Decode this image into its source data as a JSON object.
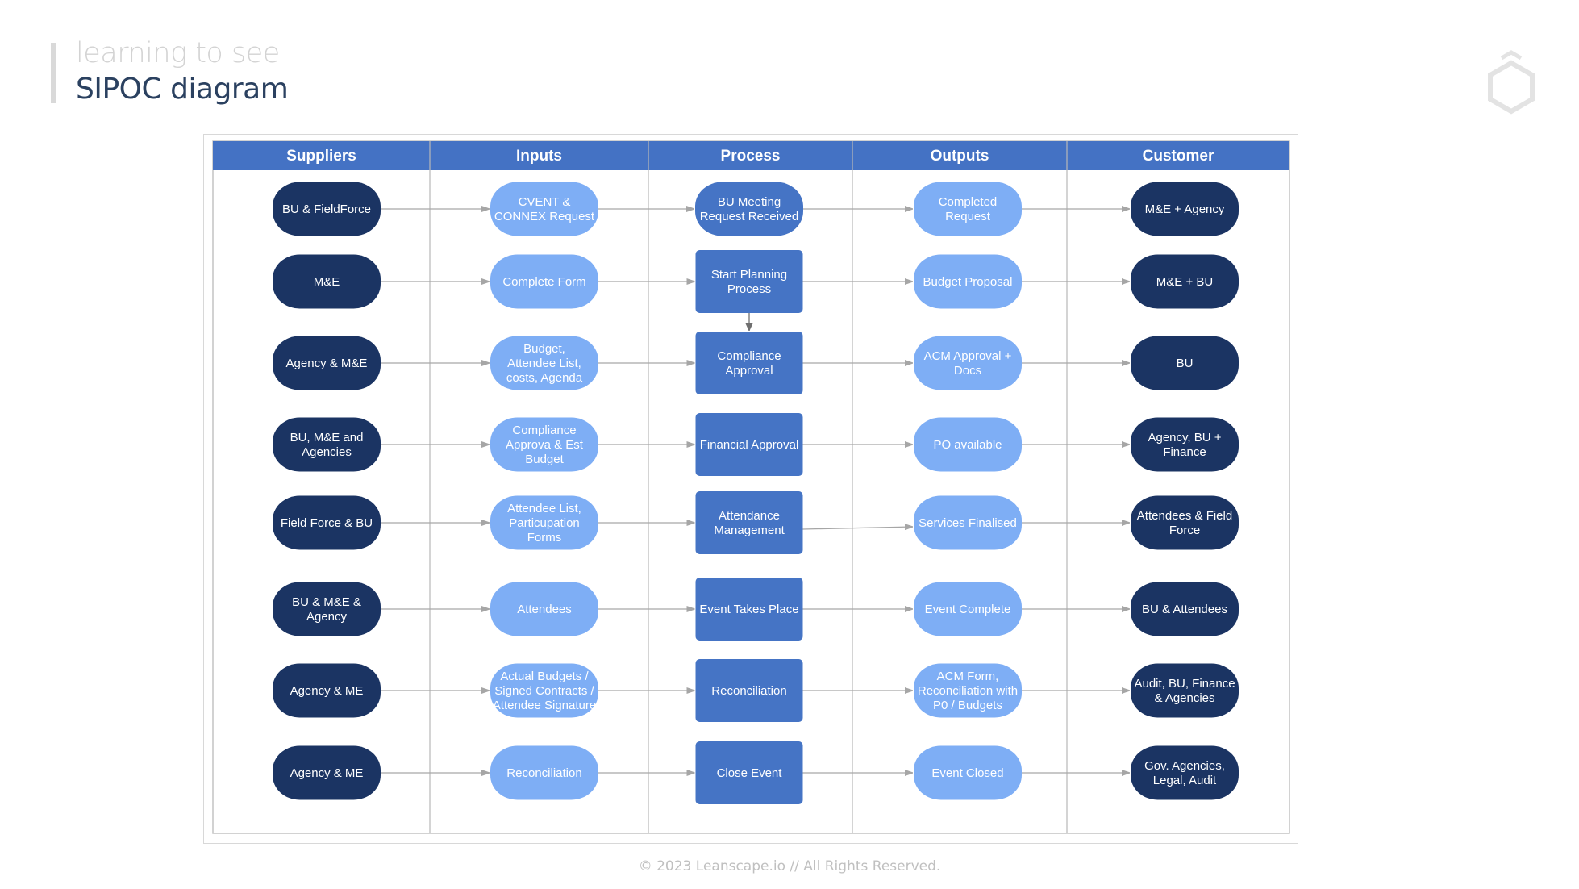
{
  "header": {
    "subtitle": "learning to see",
    "title": "SIPOC diagram",
    "logo_icon": "hexagon-logo-icon"
  },
  "colors": {
    "header_blue": "#4472c4",
    "supplier_customer_navy": "#1b3463",
    "input_output_light": "#7eaef5",
    "process_blue": "#4574c5",
    "grid_line": "#b8b8b8",
    "arrow": "#a6a6a6"
  },
  "diagram": {
    "columns": [
      {
        "key": "suppliers",
        "label": "Suppliers",
        "shape": "pill",
        "color": "supplier_customer_navy"
      },
      {
        "key": "inputs",
        "label": "Inputs",
        "shape": "pill",
        "color": "input_output_light"
      },
      {
        "key": "process",
        "label": "Process",
        "shape": "box",
        "color": "process_blue"
      },
      {
        "key": "outputs",
        "label": "Outputs",
        "shape": "pill",
        "color": "input_output_light"
      },
      {
        "key": "customer",
        "label": "Customer",
        "shape": "pill",
        "color": "supplier_customer_navy"
      }
    ],
    "rows": [
      {
        "suppliers": [
          "BU & FieldForce"
        ],
        "inputs": [
          "CVENT &",
          "CONNEX Request"
        ],
        "process": [
          "BU Meeting",
          "Request Received"
        ],
        "process_shape": "pill",
        "outputs": [
          "Completed",
          "Request"
        ],
        "customer": [
          "M&E + Agency"
        ]
      },
      {
        "suppliers": [
          "M&E"
        ],
        "inputs": [
          "Complete Form"
        ],
        "process": [
          "Start Planning",
          "Process"
        ],
        "outputs": [
          "Budget Proposal"
        ],
        "customer": [
          "M&E + BU"
        ]
      },
      {
        "suppliers": [
          "Agency & M&E"
        ],
        "inputs": [
          "Budget,",
          "Attendee List,",
          "costs, Agenda"
        ],
        "process": [
          "Compliance",
          "Approval"
        ],
        "outputs": [
          "ACM Approval +",
          "Docs"
        ],
        "customer": [
          "BU"
        ]
      },
      {
        "suppliers": [
          "BU, M&E and",
          "Agencies"
        ],
        "inputs": [
          "Compliance",
          "Approva & Est",
          "Budget"
        ],
        "process": [
          "Financial Approval"
        ],
        "outputs": [
          "PO  available"
        ],
        "customer": [
          "Agency, BU +",
          "Finance"
        ]
      },
      {
        "suppliers": [
          "Field Force & BU"
        ],
        "inputs": [
          "Attendee List,",
          "Particupation",
          "Forms"
        ],
        "process": [
          "Attendance",
          "Management"
        ],
        "outputs": [
          "Services Finalised"
        ],
        "customer": [
          "Attendees & Field",
          "Force"
        ]
      },
      {
        "suppliers": [
          "BU & M&E &",
          "Agency"
        ],
        "inputs": [
          "Attendees"
        ],
        "process": [
          "Event Takes Place"
        ],
        "outputs": [
          "Event Complete"
        ],
        "customer": [
          "BU & Attendees"
        ]
      },
      {
        "suppliers": [
          "Agency & ME"
        ],
        "inputs": [
          "Actual Budgets /",
          "Signed Contracts /",
          "Attendee Signature"
        ],
        "process": [
          "Reconciliation"
        ],
        "outputs": [
          "ACM Form,",
          "Reconciliation with",
          "P0 / Budgets"
        ],
        "customer": [
          "Audit, BU, Finance",
          "& Agencies"
        ]
      },
      {
        "suppliers": [
          "Agency & ME"
        ],
        "inputs": [
          "Reconciliation"
        ],
        "process": [
          "Close Event"
        ],
        "outputs": [
          "Event Closed"
        ],
        "customer": [
          "Gov. Agencies,",
          "Legal, Audit"
        ]
      }
    ],
    "extra_edges": [
      {
        "from": "process.1",
        "to": "process.2",
        "direction": "down"
      }
    ]
  },
  "footer": {
    "copyright": "© 2023 Leanscape.io // All Rights Reserved."
  }
}
